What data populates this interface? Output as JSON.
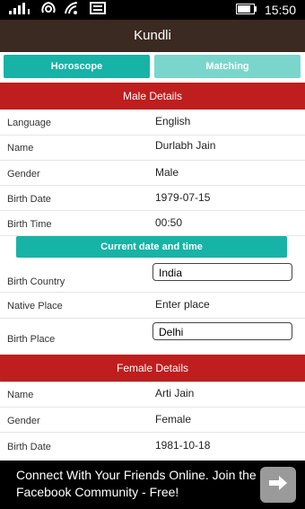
{
  "status": {
    "time": "15:50"
  },
  "app": {
    "title": "Kundli"
  },
  "tabs": [
    {
      "label": "Horoscope"
    },
    {
      "label": "Matching"
    }
  ],
  "male": {
    "header": "Male Details",
    "language_label": "Language",
    "language_value": "English",
    "name_label": "Name",
    "name_value": "Durlabh Jain",
    "gender_label": "Gender",
    "gender_value": "Male",
    "birth_date_label": "Birth Date",
    "birth_date_value": "1979-07-15",
    "birth_time_label": "Birth Time",
    "birth_time_value": "00:50",
    "current_button": "Current date and time",
    "birth_country_label": "Birth Country",
    "birth_country_value": "India",
    "native_place_label": "Native Place",
    "native_place_placeholder": "Enter place",
    "birth_place_label": "Birth Place",
    "birth_place_value": "Delhi"
  },
  "female": {
    "header": "Female Details",
    "name_label": "Name",
    "name_value": "Arti Jain",
    "gender_label": "Gender",
    "gender_value": "Female",
    "birth_date_label": "Birth Date",
    "birth_date_value": "1981-10-18"
  },
  "ad": {
    "text": "Connect With Your Friends Online. Join the Facebook Community - Free!"
  },
  "colors": {
    "teal": "#17b3a6",
    "teal_light": "#7ad6cc",
    "header_red": "#be1e1e",
    "titlebar": "#3b2a22"
  }
}
